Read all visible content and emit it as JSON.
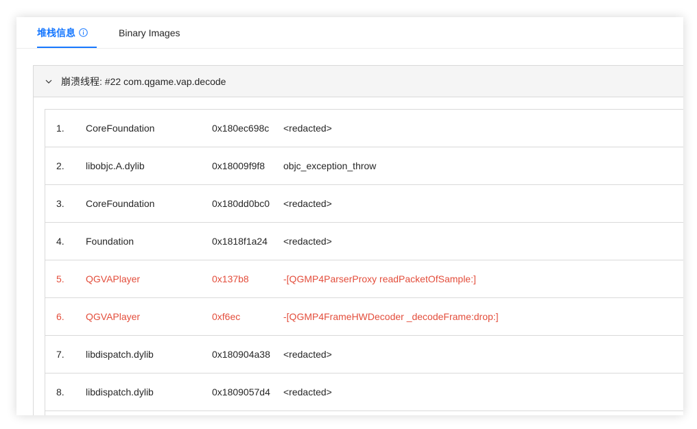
{
  "tabs": [
    {
      "label": "堆栈信息",
      "active": true
    },
    {
      "label": "Binary Images",
      "active": false
    }
  ],
  "panel": {
    "title": "崩溃线程: #22 com.qgame.vap.decode"
  },
  "colors": {
    "accent": "#1677ff",
    "highlight": "#e34d3b"
  },
  "frames": [
    {
      "index": "1.",
      "module": "CoreFoundation",
      "address": "0x180ec698c",
      "symbol": "<redacted>",
      "highlight": false
    },
    {
      "index": "2.",
      "module": "libobjc.A.dylib",
      "address": "0x18009f9f8",
      "symbol": "objc_exception_throw",
      "highlight": false
    },
    {
      "index": "3.",
      "module": "CoreFoundation",
      "address": "0x180dd0bc0",
      "symbol": "<redacted>",
      "highlight": false
    },
    {
      "index": "4.",
      "module": "Foundation",
      "address": "0x1818f1a24",
      "symbol": "<redacted>",
      "highlight": false
    },
    {
      "index": "5.",
      "module": "QGVAPlayer",
      "address": "0x137b8",
      "symbol": "-[QGMP4ParserProxy readPacketOfSample:]",
      "highlight": true
    },
    {
      "index": "6.",
      "module": "QGVAPlayer",
      "address": "0xf6ec",
      "symbol": "-[QGMP4FrameHWDecoder _decodeFrame:drop:]",
      "highlight": true
    },
    {
      "index": "7.",
      "module": "libdispatch.dylib",
      "address": "0x180904a38",
      "symbol": "<redacted>",
      "highlight": false
    },
    {
      "index": "8.",
      "module": "libdispatch.dylib",
      "address": "0x1809057d4",
      "symbol": "<redacted>",
      "highlight": false
    },
    {
      "index": "9.",
      "module": "",
      "address": "",
      "symbol": "",
      "highlight": false
    }
  ]
}
